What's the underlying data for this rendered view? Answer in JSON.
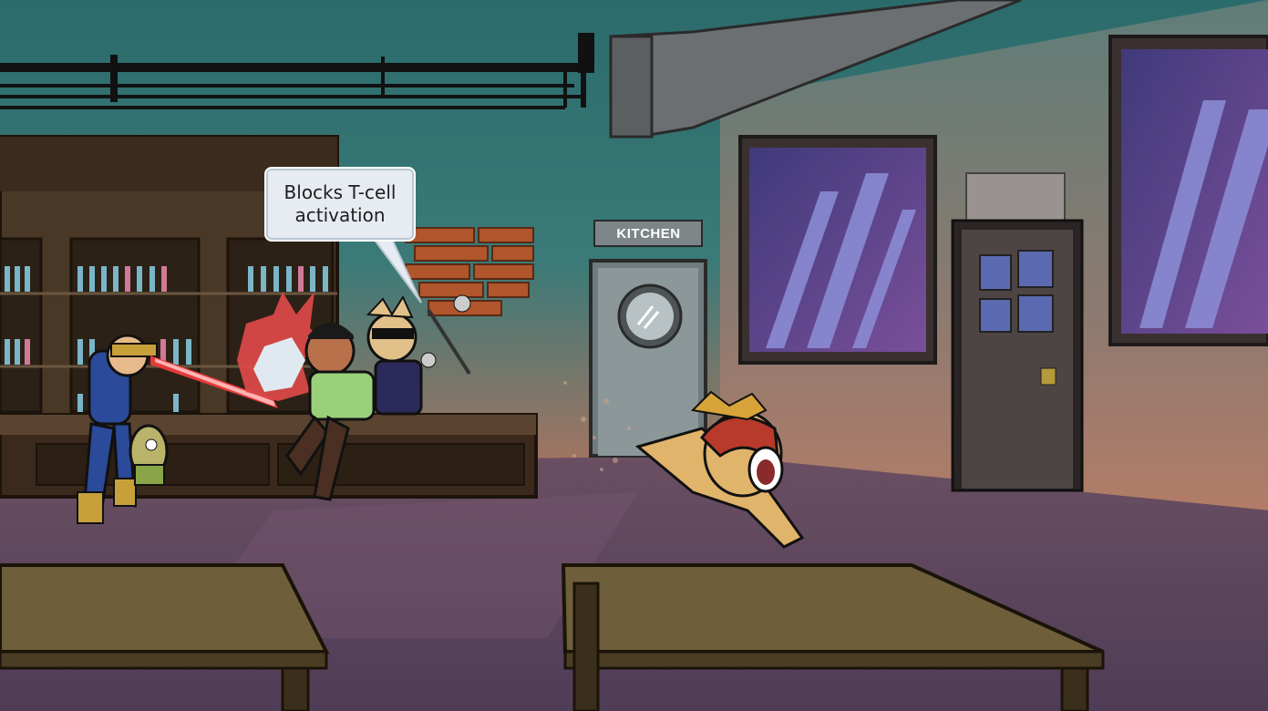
{
  "scene": {
    "speech_bubble": {
      "line1": "Blocks T-cell",
      "line2": "activation"
    },
    "kitchen_sign": "KITCHEN"
  },
  "colors": {
    "sky_top": "#2f6a6a",
    "sky_bottom": "#b07a5c",
    "floor": "#5b4860",
    "wall": "#8c7f7a",
    "table": "#6b5a3a",
    "window_glass": "#4b3f8f"
  }
}
